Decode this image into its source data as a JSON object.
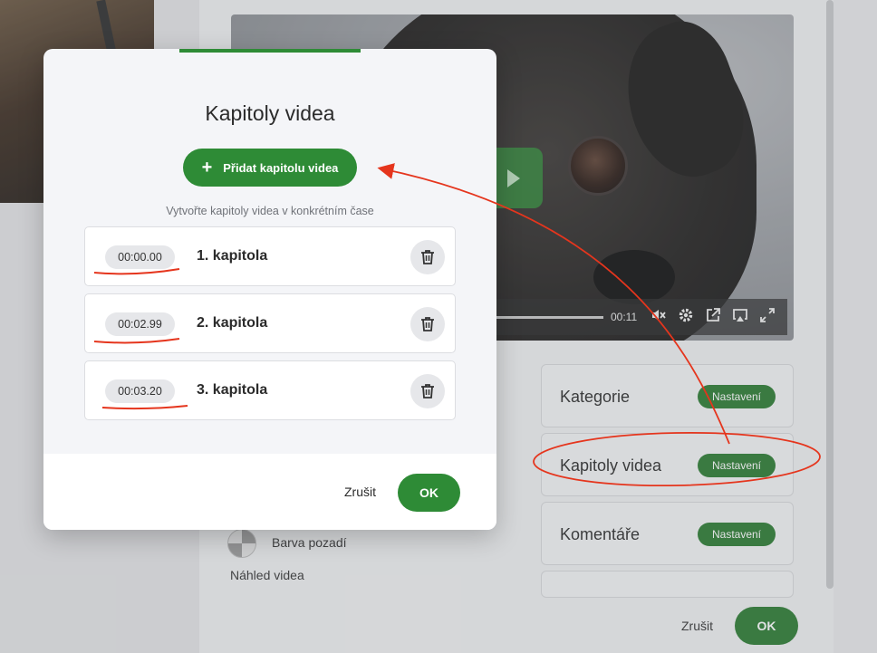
{
  "modal": {
    "title": "Kapitoly videa",
    "add_label": "Přidat kapitolu videa",
    "hint": "Vytvořte kapitoly videa v konkrétním čase",
    "chapters": [
      {
        "time": "00:00.00",
        "name": "1. kapitola"
      },
      {
        "time": "00:02.99",
        "name": "2. kapitola"
      },
      {
        "time": "00:03.20",
        "name": "3. kapitola"
      }
    ],
    "cancel_label": "Zrušit",
    "ok_label": "OK"
  },
  "background": {
    "video_time": "00:11",
    "cards": [
      {
        "label": "Kategorie",
        "button": "Nastavení"
      },
      {
        "label": "Kapitoly videa",
        "button": "Nastavení"
      },
      {
        "label": "Komentáře",
        "button": "Nastavení"
      }
    ],
    "bg_color_label": "Barva pozadí",
    "preview_label": "Náhled videa",
    "cancel_label": "Zrušit",
    "ok_label": "OK"
  },
  "colors": {
    "accent": "#2e8b36",
    "annotation": "#e5351d"
  }
}
